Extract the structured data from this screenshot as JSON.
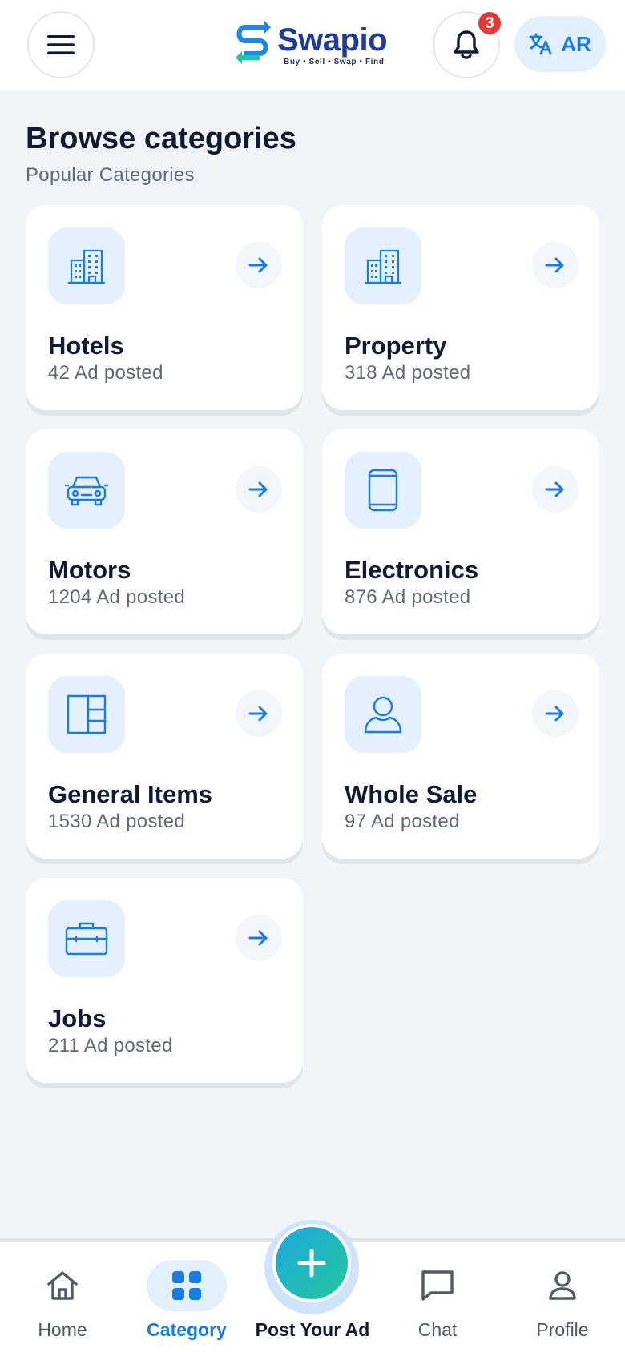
{
  "header": {
    "menu_icon": "hamburger-menu-icon",
    "logo": {
      "name": "Swapio",
      "tagline": "Buy • Sell • Swap • Find"
    },
    "notifications": {
      "icon": "bell-icon",
      "count": "3"
    },
    "language": {
      "icon": "translate-icon",
      "label": "AR"
    }
  },
  "page": {
    "title": "Browse categories",
    "subtitle": "Popular Categories"
  },
  "categories": [
    {
      "title": "Hotels",
      "count": "42 Ad posted",
      "icon": "building-icon"
    },
    {
      "title": "Property",
      "count": "318 Ad posted",
      "icon": "building-icon"
    },
    {
      "title": "Motors",
      "count": "1204 Ad posted",
      "icon": "car-icon"
    },
    {
      "title": "Electronics",
      "count": "876 Ad posted",
      "icon": "phone-icon"
    },
    {
      "title": "General Items",
      "count": "1530 Ad posted",
      "icon": "layout-grid-icon"
    },
    {
      "title": "Whole Sale",
      "count": "97 Ad posted",
      "icon": "user-icon"
    },
    {
      "title": "Jobs",
      "count": "211 Ad posted",
      "icon": "briefcase-icon"
    }
  ],
  "nav": {
    "home": "Home",
    "category": "Category",
    "post": "Post Your Ad",
    "chat": "Chat",
    "profile": "Profile",
    "active": "category"
  },
  "colors": {
    "accent": "#1a7be0",
    "background": "#f1f5fa",
    "badge": "#e53935",
    "icon_tile": "#e4f0fd",
    "fab_gradient": [
      "#1da7e0",
      "#22c79a"
    ]
  }
}
